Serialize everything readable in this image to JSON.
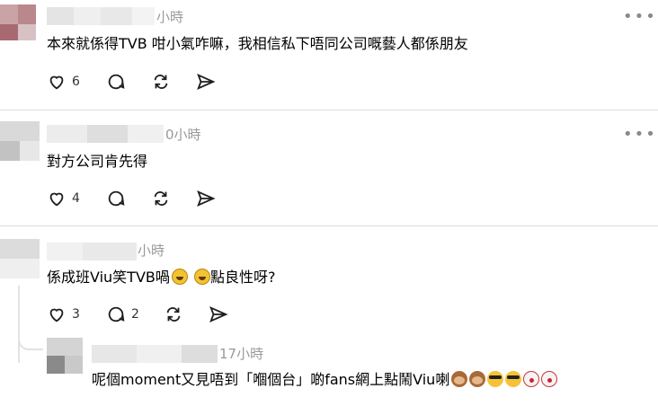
{
  "posts": [
    {
      "time": "小時",
      "text": "本來就係得TVB 咁小氣咋嘛，我相信私下唔同公司嘅藝人都係朋友",
      "likes": "6",
      "comments": ""
    },
    {
      "time": "0小時",
      "text": "對方公司肯先得",
      "likes": "4",
      "comments": ""
    },
    {
      "time": "小時",
      "text": "係成班Viu笑TVB喎",
      "text_after": "點良性呀?",
      "likes": "3",
      "comments": "2"
    },
    {
      "time": "17小時",
      "text": "呢個moment又見唔到「嗰個台」啲fans網上點鬧Viu喇"
    }
  ],
  "colors": {
    "divider": "#dcdcdc",
    "muted_text": "#999999",
    "icon": "#1f1f1f"
  },
  "icons": [
    "heart-icon",
    "comment-icon",
    "repost-icon",
    "share-icon",
    "more-icon"
  ]
}
